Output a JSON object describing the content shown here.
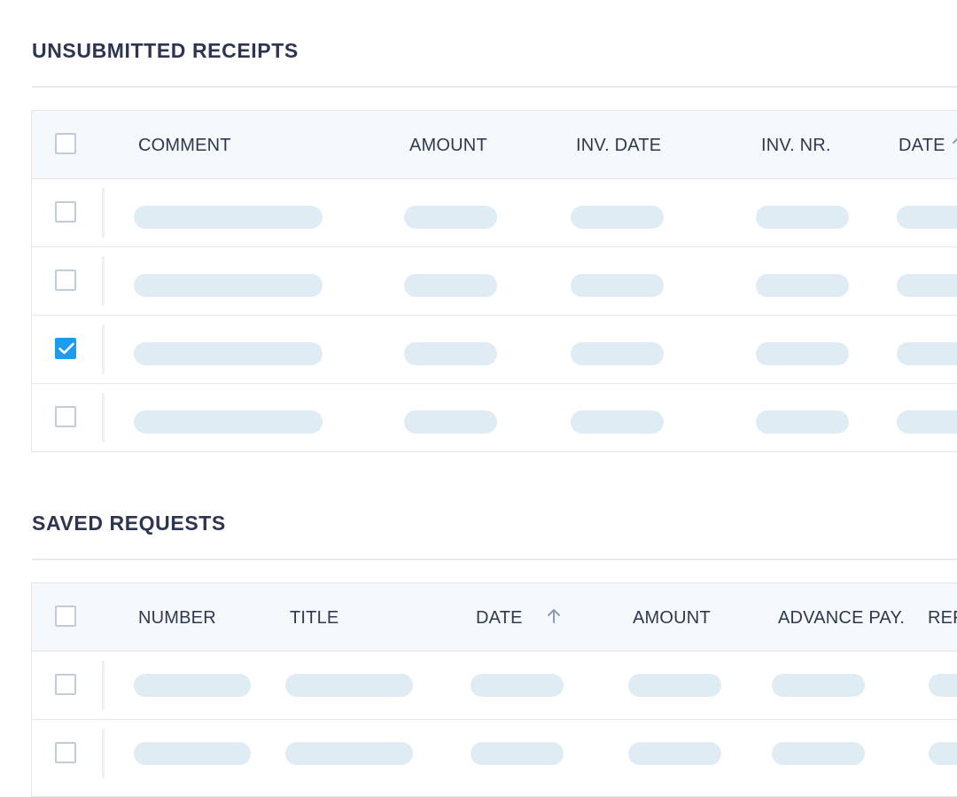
{
  "unsubmitted": {
    "title": "UNSUBMITTED RECEIPTS",
    "columns": [
      "COMMENT",
      "AMOUNT",
      "INV. DATE",
      "INV. NR.",
      "DATE"
    ],
    "sorted_column": "DATE",
    "sort_direction": "ascending",
    "row_count": 4,
    "rows_checked": [
      false,
      false,
      true,
      false
    ]
  },
  "saved": {
    "title": "SAVED REQUESTS",
    "columns": [
      "NUMBER",
      "TITLE",
      "DATE",
      "AMOUNT",
      "ADVANCE PAY.",
      "REF"
    ],
    "sorted_column": "DATE",
    "sort_direction": "ascending",
    "row_count": 2,
    "rows_checked": [
      false,
      false
    ]
  },
  "colors": {
    "checkbox_checked": "#1d9bef",
    "placeholder": "#dfecf3",
    "header_bg": "#f6f9fb",
    "title_text": "#2d3550"
  },
  "icons": [
    "checkbox-icon",
    "checkmark-icon",
    "sort-ascending-arrow-icon"
  ]
}
